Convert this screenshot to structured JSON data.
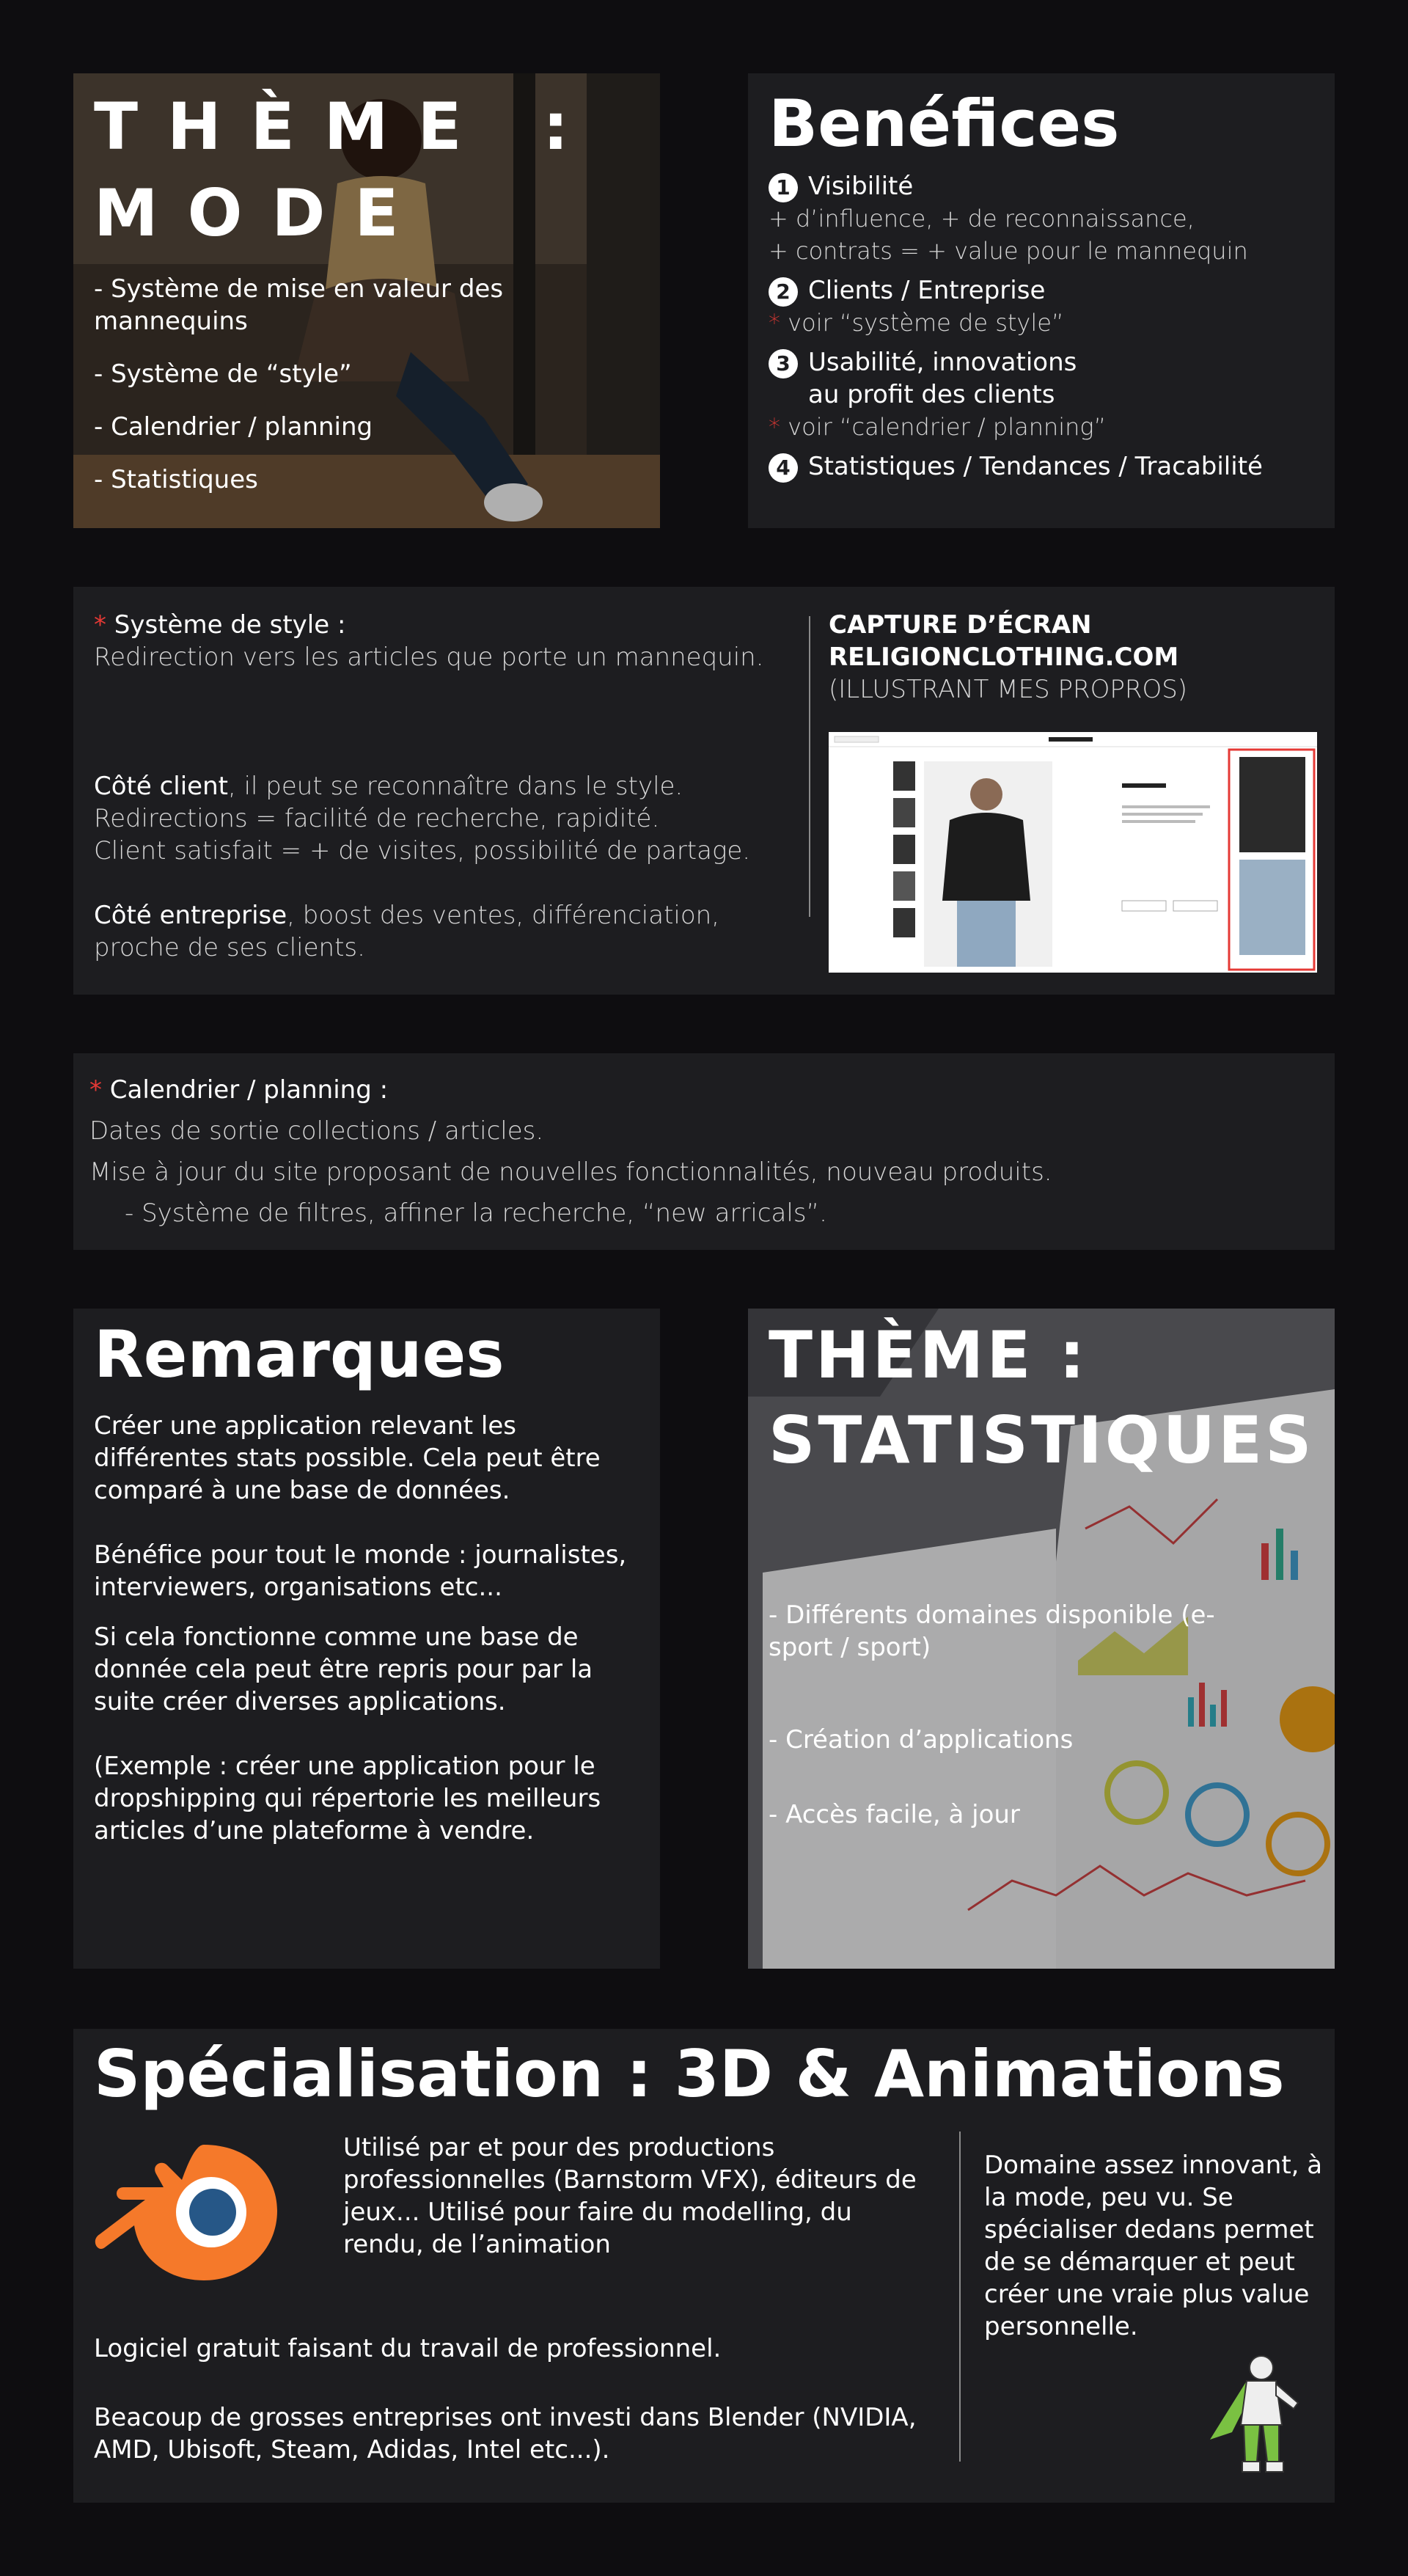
{
  "mode": {
    "title_line1": "THÈME :",
    "title_line2": "MODE",
    "items": [
      "- Système de mise en valeur des mannequins",
      "- Système de “style”",
      "- Calendrier / planning",
      "- Statistiques"
    ]
  },
  "benefices": {
    "title": "Benéfices",
    "b1": {
      "num": "1",
      "head": "Visibilité",
      "text_line1": "+ d’influence, + de reconnaissance,",
      "text_line2": "+ contrats = + value pour le mannequin"
    },
    "b2": {
      "num": "2",
      "head": "Clients / Entreprise",
      "asterisk": "*",
      "text": " voir “système de style”"
    },
    "b3": {
      "num": "3",
      "head_line1": "Usabilité, innovations",
      "head_line2": "au profit des clients",
      "asterisk": "*",
      "text": " voir “calendrier / planning”"
    },
    "b4": {
      "num": "4",
      "head": "Statistiques / Tendances / Tracabilité"
    }
  },
  "style_system": {
    "asterisk": "*",
    "heading": " Système de style :",
    "intro": "Redirection vers les articles que porte un mannequin.",
    "client_bold": "Côté client",
    "client_rest": ", il peut se reconnaître dans le style.",
    "client_line2": "Redirections = facilité de recherche, rapidité.",
    "client_line3": "Client satisfait = + de visites, possibilité de partage.",
    "ent_bold": "Côté entreprise",
    "ent_rest": ", boost des ventes, différenciation,",
    "ent_line2": "proche de ses clients.",
    "capture_line1": "CAPTURE D’ÉCRAN",
    "capture_line2": "RELIGIONCLOTHING.COM",
    "capture_line3": "(ILLUSTRANT MES PROPROS)"
  },
  "calendar": {
    "asterisk": "*",
    "heading": " Calendrier / planning :",
    "line1": "Dates de sortie collections / articles.",
    "line2": "Mise à jour du site proposant de nouvelles fonctionnalités, nouveau produits.",
    "line3": "- Système de filtres, affiner la recherche, “new arricals”."
  },
  "remarques": {
    "title": "Remarques",
    "p1": "Créer une application relevant les différentes stats possible. Cela peut être comparé à une base de données.",
    "p2": "Bénéfice pour tout le monde : journalistes, interviewers, organisations etc...",
    "p3": "Si cela fonctionne comme une base de donnée cela peut être repris pour par la suite créer diverses applications.",
    "p4": "(Exemple : créer une application pour le dropshipping qui répertorie les meilleurs articles d’une plateforme à vendre."
  },
  "statistiques": {
    "title_line1": "THÈME :",
    "title_line2": "STATISTIQUES",
    "items": [
      "- Différents domaines disponible (e-sport / sport)",
      "- Création d’applications",
      "- Accès facile, à jour"
    ]
  },
  "specialisation": {
    "title": "Spécialisation : 3D & Animations",
    "text1": "Utilisé par et pour des productions professionnelles (Barnstorm VFX), éditeurs de jeux... Utilisé pour faire du modelling, du rendu, de l’animation",
    "text2": "Logiciel gratuit faisant du travail de professionnel.",
    "text3": "Beacoup de grosses entreprises ont investi dans Blender (NVIDIA, AMD, Ubisoft, Steam, Adidas, Intel etc...).",
    "side": "Domaine assez innovant, à la mode, peu vu. Se spécialiser dedans permet de se démarquer et peut créer une vraie plus value personnelle."
  },
  "colors": {
    "background": "#0e0d10",
    "card": "#1d1d20",
    "accent_red": "#e53935",
    "blender_orange": "#f5792a",
    "blender_blue": "#265787"
  }
}
